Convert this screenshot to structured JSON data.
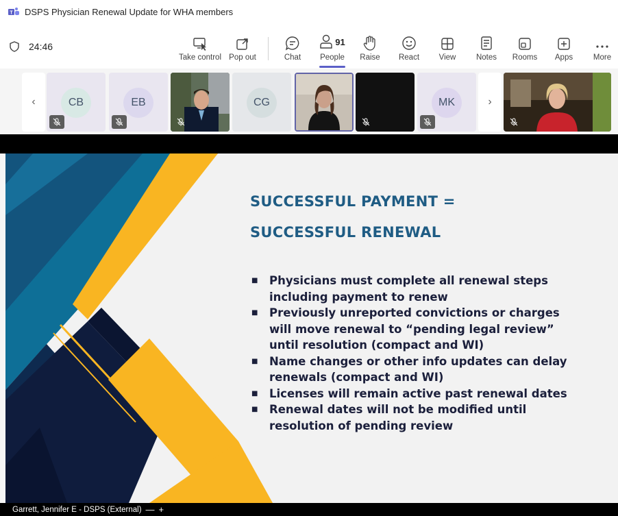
{
  "window": {
    "title": "DSPS Physician Renewal Update for WHA members"
  },
  "toolbar": {
    "timer": "24:46",
    "buttons": {
      "take_control": "Take control",
      "pop_out": "Pop out",
      "chat": "Chat",
      "people": "People",
      "raise": "Raise",
      "react": "React",
      "view": "View",
      "notes": "Notes",
      "rooms": "Rooms",
      "apps": "Apps",
      "more": "More"
    },
    "people_count": "91"
  },
  "participants": {
    "prev_icon": "chevron-left-icon",
    "next_icon": "chevron-right-icon",
    "tiles": [
      {
        "initials": "CB",
        "muted": true
      },
      {
        "initials": "EB",
        "muted": true
      },
      {
        "video": true,
        "muted": true
      },
      {
        "initials": "CG",
        "muted": false
      },
      {
        "video": true,
        "selected": true
      },
      {
        "video": true,
        "muted": true
      },
      {
        "initials": "MK",
        "muted": true
      },
      {
        "video": true,
        "muted": true
      }
    ]
  },
  "slide": {
    "heading_line1": "SUCCESSFUL PAYMENT =",
    "heading_line2": "SUCCESSFUL RENEWAL",
    "bullets": [
      "Physicians must complete all renewal steps including payment to renew",
      "Previously unreported convictions or charges will move renewal to “pending legal review” until resolution (compact and WI)",
      "Name changes or other info updates can delay renewals (compact and WI)",
      "Licenses will remain active past renewal dates",
      "Renewal dates will not be modified until resolution of pending review"
    ],
    "colors": {
      "heading": "#1f5c84",
      "accent_yellow": "#f9b522",
      "navy": "#0f1c3d",
      "teal": "#0e6f97"
    }
  },
  "bottombar": {
    "speaker": "Garrett, Jennifer E - DSPS (External)",
    "dash": "—",
    "plus": "+"
  }
}
